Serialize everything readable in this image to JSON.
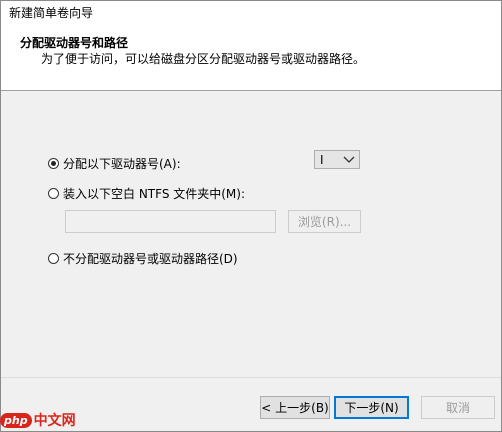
{
  "window": {
    "title": "新建简单卷向导"
  },
  "header": {
    "title": "分配驱动器号和路径",
    "subtitle": "为了便于访问，可以给磁盘分区分配驱动器号或驱动器路径。"
  },
  "options": {
    "assign_letter": {
      "label": "分配以下驱动器号(A):",
      "checked": true
    },
    "drive_letter": {
      "value": "I"
    },
    "mount_folder": {
      "label": "装入以下空白 NTFS 文件夹中(M):",
      "checked": false
    },
    "folder_path": {
      "value": ""
    },
    "browse_label": "浏览(R)...",
    "no_assign": {
      "label": "不分配驱动器号或驱动器路径(D)",
      "checked": false
    }
  },
  "footer": {
    "back_label": "< 上一步(B)",
    "next_label": "下一步(N)",
    "cancel_label": "取消"
  },
  "watermark": {
    "logo_text": "php",
    "site_text": "中文网"
  },
  "colors": {
    "accent": "#0078d7",
    "panel": "#f0f0f0",
    "watermark": "#d9261c"
  },
  "icons": {
    "dropdown": "chevron-down-icon"
  }
}
